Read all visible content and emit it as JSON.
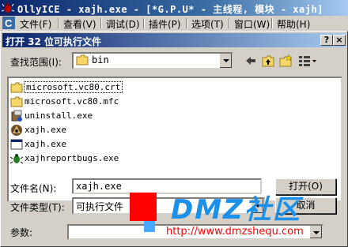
{
  "window": {
    "title": "OllyICE - xajh.exe - [*G.P.U* -  主线程, 模块 - xajh]"
  },
  "menu": {
    "items": [
      "文件(F)",
      "查看(V)",
      "调试(D)",
      "插件(P)",
      "选项(T)",
      "窗口(W)",
      "帮助(H)"
    ]
  },
  "dialog": {
    "title": "打开 32 位可执行文件",
    "help_button": "?",
    "close_button": "×",
    "look_in_label": "查找范围(I):",
    "look_in_value": "bin",
    "files": [
      {
        "name": "microsoft.vc80.crt",
        "icon": "folder-icon"
      },
      {
        "name": "microsoft.vc80.mfc",
        "icon": "folder-icon"
      },
      {
        "name": "uninstall.exe",
        "icon": "installer-icon"
      },
      {
        "name": "xajh.exe",
        "icon": "game-app-icon"
      },
      {
        "name": "xajh.exe",
        "icon": "exe-window-icon"
      },
      {
        "name": "xajhreportbugs.exe",
        "icon": "bug-report-icon"
      }
    ],
    "filename_label": "文件名(N):",
    "filename_value": "xajh.exe",
    "filetype_label": "文件类型(T):",
    "filetype_value": "可执行文件",
    "args_label": "参数:",
    "args_value": "",
    "open_button": "打开(O)",
    "cancel_button": "取消"
  },
  "watermark": {
    "text": "DMZ社区",
    "url": "http://www.dmzshequ.com"
  },
  "colors": {
    "title_dark": "#0a246a",
    "title_light": "#a6caf0",
    "face": "#d4d0c8",
    "watermark_blue": "#1a90e8",
    "watermark_red": "#ff0000"
  }
}
